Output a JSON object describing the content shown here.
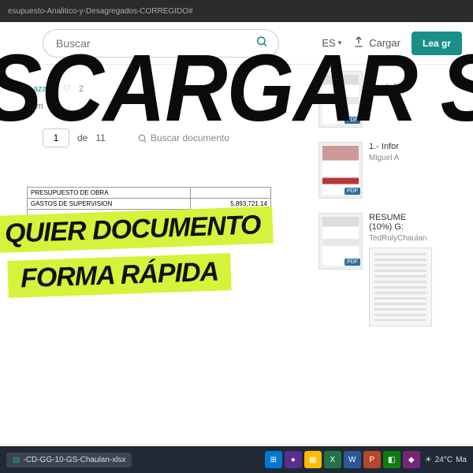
{
  "browser": {
    "url": "esupuesto-Analitico-y-Desagregados-CORREGIDO#"
  },
  "header": {
    "search_placeholder": "Buscar",
    "lang": "ES",
    "upload": "Cargar",
    "cta": "Lea gr"
  },
  "doc": {
    "author_fragment": "aza V",
    "views_fragment": "2",
    "desc": "rm",
    "page_current": "1",
    "page_sep": "de",
    "page_total": "11",
    "search_doc": "Buscar documento",
    "tbl": {
      "r1": "PRESUPUESTO DE OBRA",
      "r2": "GASTOS DE SUPERVISION",
      "v1": "5,893,721.14"
    }
  },
  "sidebar": {
    "items": [
      {
        "title": "G",
        "author": "amado20"
      },
      {
        "title": "1.- Infor",
        "author": "Miguel A"
      },
      {
        "title": "RESUME",
        "subtitle": "(10%) G:",
        "author": "TedRolyChaulan"
      }
    ]
  },
  "overlay": {
    "big": "SCARGAR SCI",
    "tag1": "QUIER DOCUMENTO",
    "tag2": "FORMA RÁPIDA"
  },
  "taskbar": {
    "file": "-CD-GG-10-GS-Chaulan-xlsx",
    "weather_temp": "24°C",
    "weather_cond": "Ma",
    "app_colors": [
      "#0078d4",
      "#ff8c00",
      "#107c10",
      "#217346",
      "#2b579a",
      "#b7472a",
      "#742774",
      "#5b2d90"
    ]
  }
}
